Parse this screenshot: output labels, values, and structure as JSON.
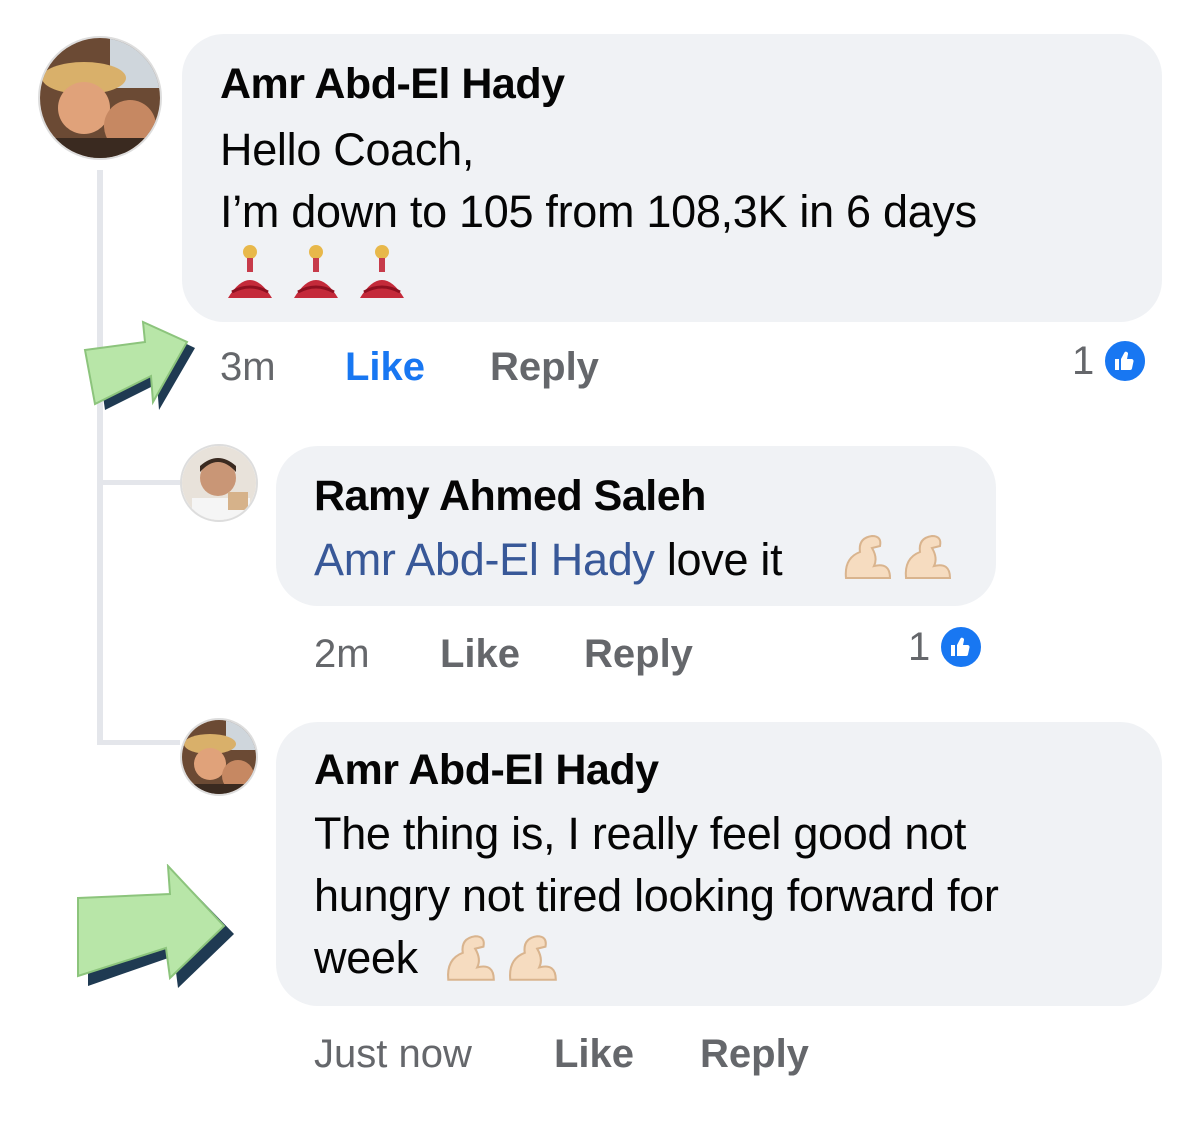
{
  "comments": [
    {
      "author": "Amr Abd-El Hady",
      "lines": [
        "Hello Coach,",
        "I’m down to 105 from 108,3K  in 6 days"
      ],
      "emojis": [
        "dancer-emoji",
        "dancer-emoji",
        "dancer-emoji"
      ],
      "time": "3m",
      "like_label": "Like",
      "reply_label": "Reply",
      "reaction_count": "1",
      "liked": true
    },
    {
      "author": "Ramy Ahmed Saleh",
      "mention": "Amr Abd-El Hady",
      "text": " love it",
      "emojis": [
        "flexed-biceps-emoji",
        "flexed-biceps-emoji"
      ],
      "time": "2m",
      "like_label": "Like",
      "reply_label": "Reply",
      "reaction_count": "1",
      "liked": false
    },
    {
      "author": "Amr Abd-El Hady",
      "lines": [
        "The thing is, I really feel good not",
        "hungry not tired looking forward for",
        "week"
      ],
      "emojis": [
        "flexed-biceps-emoji",
        "flexed-biceps-emoji"
      ],
      "time": "Just now",
      "like_label": "Like",
      "reply_label": "Reply",
      "liked": false
    }
  ],
  "colors": {
    "bubble": "#f0f2f5",
    "link": "#385898",
    "like_active": "#1877f2",
    "meta": "#65676b",
    "arrow": "#b8e6a8"
  }
}
